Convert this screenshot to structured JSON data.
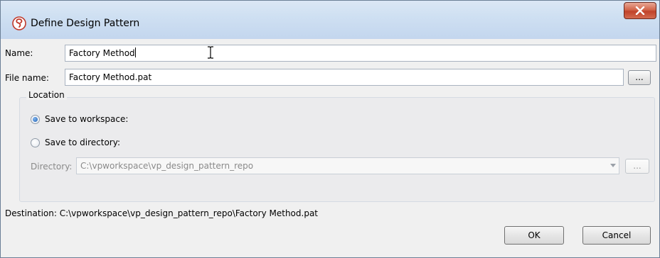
{
  "window": {
    "title": "Define Design Pattern",
    "icon": "visual-paradigm-logo-icon",
    "close_icon": "close-x-icon"
  },
  "form": {
    "name_label": "Name:",
    "name_value": "Factory Method",
    "file_name_label": "File name:",
    "file_name_value": "Factory Method.pat",
    "browse_label": "..."
  },
  "location": {
    "legend": "Location",
    "save_workspace_label": "Save to workspace:",
    "save_workspace_selected": true,
    "save_directory_label": "Save to directory:",
    "save_directory_selected": false,
    "directory_label": "Directory:",
    "directory_value": "C:\\vpworkspace\\vp_design_pattern_repo",
    "directory_browse_label": "..."
  },
  "destination": {
    "text": "Destination: C:\\vpworkspace\\vp_design_pattern_repo\\Factory Method.pat"
  },
  "buttons": {
    "ok": "OK",
    "cancel": "Cancel"
  },
  "colors": {
    "title_bar": "#cfe0f2",
    "close_button": "#c0422a",
    "radio_selected": "#2463b3"
  }
}
